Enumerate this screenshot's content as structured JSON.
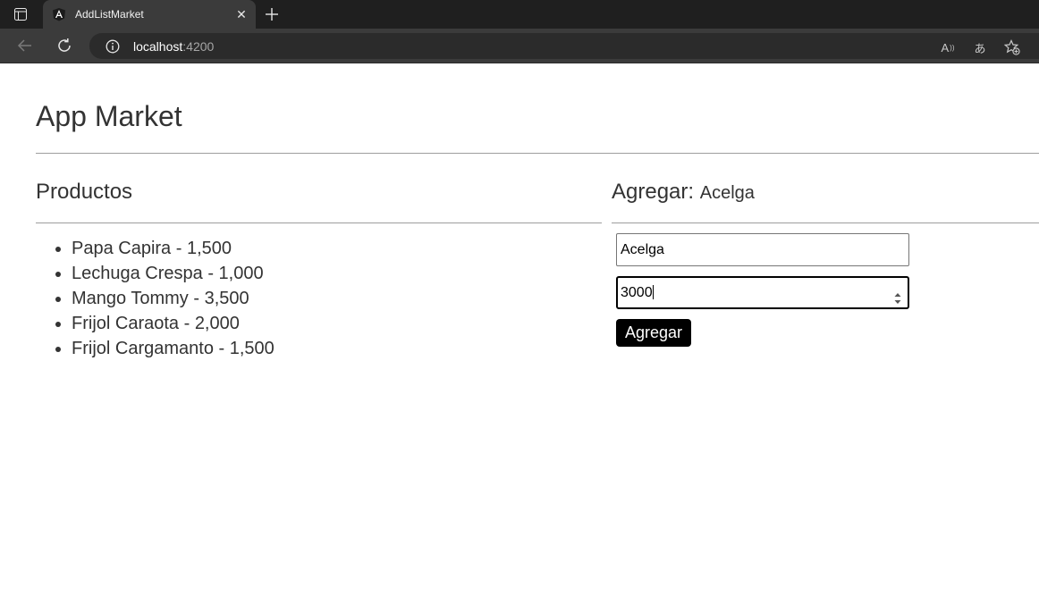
{
  "browser": {
    "tab_title": "AddListMarket",
    "tab_close": "✕",
    "url_host": "localhost",
    "url_port": ":4200",
    "read_aloud_label": "A",
    "translate_label": "あ"
  },
  "page": {
    "title": "App Market",
    "products_heading": "Productos",
    "add_heading": "Agregar:",
    "add_heading_item": "Acelga",
    "products": [
      "Papa Capira - 1,500",
      "Lechuga Crespa - 1,000",
      "Mango Tommy - 3,500",
      "Frijol Caraota - 2,000",
      "Frijol Cargamanto - 1,500"
    ],
    "form": {
      "name_value": "Acelga",
      "price_value": "3000",
      "submit_label": "Agregar"
    }
  }
}
